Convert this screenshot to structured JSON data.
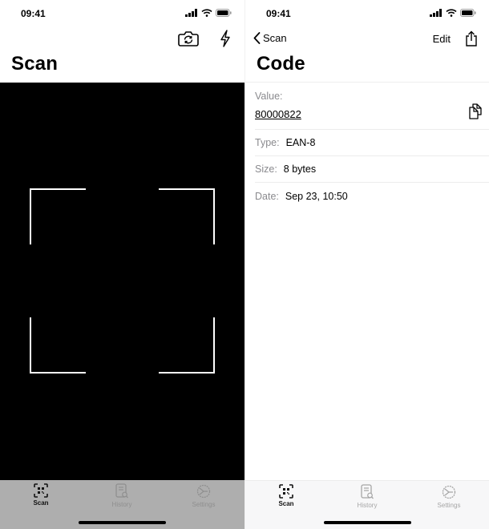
{
  "status_bar": {
    "time": "09:41"
  },
  "scan_screen": {
    "title": "Scan",
    "toolbar": {
      "switch_camera": "camera-switch-icon",
      "flash": "flash-icon"
    },
    "viewfinder": {
      "color": "#ffffff",
      "background": "#000000"
    }
  },
  "code_screen": {
    "back_label": "Scan",
    "edit_label": "Edit",
    "title": "Code",
    "value_label": "Value:",
    "value": "80000822",
    "type_label": "Type:",
    "type": "EAN-8",
    "size_label": "Size:",
    "size": "8 bytes",
    "date_label": "Date:",
    "date": "Sep 23, 10:50"
  },
  "tabbar": {
    "items": [
      {
        "label": "Scan",
        "icon": "qr-scan-icon",
        "active": true
      },
      {
        "label": "History",
        "icon": "history-doc-icon",
        "active": false
      },
      {
        "label": "Settings",
        "icon": "settings-gear-icon",
        "active": false
      }
    ]
  }
}
